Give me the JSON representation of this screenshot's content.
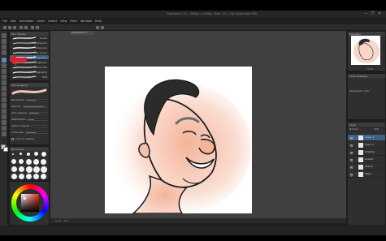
{
  "window": {
    "title": "Illustration 1 (*) - 1500px x 1500px 72dpi 17% - Clip Studio Paint PRO",
    "controls": [
      "—",
      "❐",
      "✕"
    ]
  },
  "menu": [
    "File",
    "Edit",
    "Animation",
    "Layer",
    "Select",
    "View",
    "Filter",
    "Window",
    "Help"
  ],
  "document_tab": "Illustration 1",
  "subtool_panel": {
    "tabs": [
      "Pen",
      "Marker"
    ],
    "brushes": [
      {
        "name": "G-pen",
        "selected": false
      },
      {
        "name": "Mapping pen",
        "selected": false
      },
      {
        "name": "Turnip pen",
        "selected": false
      },
      {
        "name": "Real G-pen",
        "selected": false
      },
      {
        "name": "Textured pen",
        "selected": true
      },
      {
        "name": "Rough pen",
        "selected": false
      },
      {
        "name": "For effect lines",
        "selected": false
      },
      {
        "name": "Calligraphy",
        "selected": false
      },
      {
        "name": "Soft",
        "selected": false
      }
    ]
  },
  "tool_property": {
    "header": "Tool property",
    "rows": [
      {
        "label": "Brush Size",
        "value": 0.45
      },
      {
        "label": "Opacity",
        "value": 0.9
      },
      {
        "label": "Anti-aliasing",
        "value": 0.6
      },
      {
        "label": "Stabilization",
        "value": 0.3
      },
      {
        "label": "Vector magnet",
        "value": 0.0
      },
      {
        "label": "Thickness",
        "value": 0.5
      }
    ],
    "option": "Lock to opaque"
  },
  "brush_size_panel": {
    "header": "Brush Size"
  },
  "navigator": {
    "header": "Navigator",
    "zoom": "17.6"
  },
  "layer_property": {
    "header": "Layer Property",
    "label": "Expression color"
  },
  "layers": {
    "header": "Layer",
    "blend": "Normal",
    "opacity": "100",
    "items": [
      {
        "name": "Layer 3",
        "selected": true
      },
      {
        "name": "Layer 2",
        "selected": false
      },
      {
        "name": "Shading",
        "selected": false
      },
      {
        "name": "Lineart",
        "selected": false
      },
      {
        "name": "Sketch",
        "selected": false
      },
      {
        "name": "Paper",
        "selected": false
      }
    ]
  },
  "statusbar": {
    "zoom": "17.6",
    "angle": "0.0"
  },
  "colors": {
    "main": "#f1c6b7",
    "sub": "#ffffff",
    "accent": "#5d88b7",
    "annotation_arrow": "#d9252c"
  }
}
